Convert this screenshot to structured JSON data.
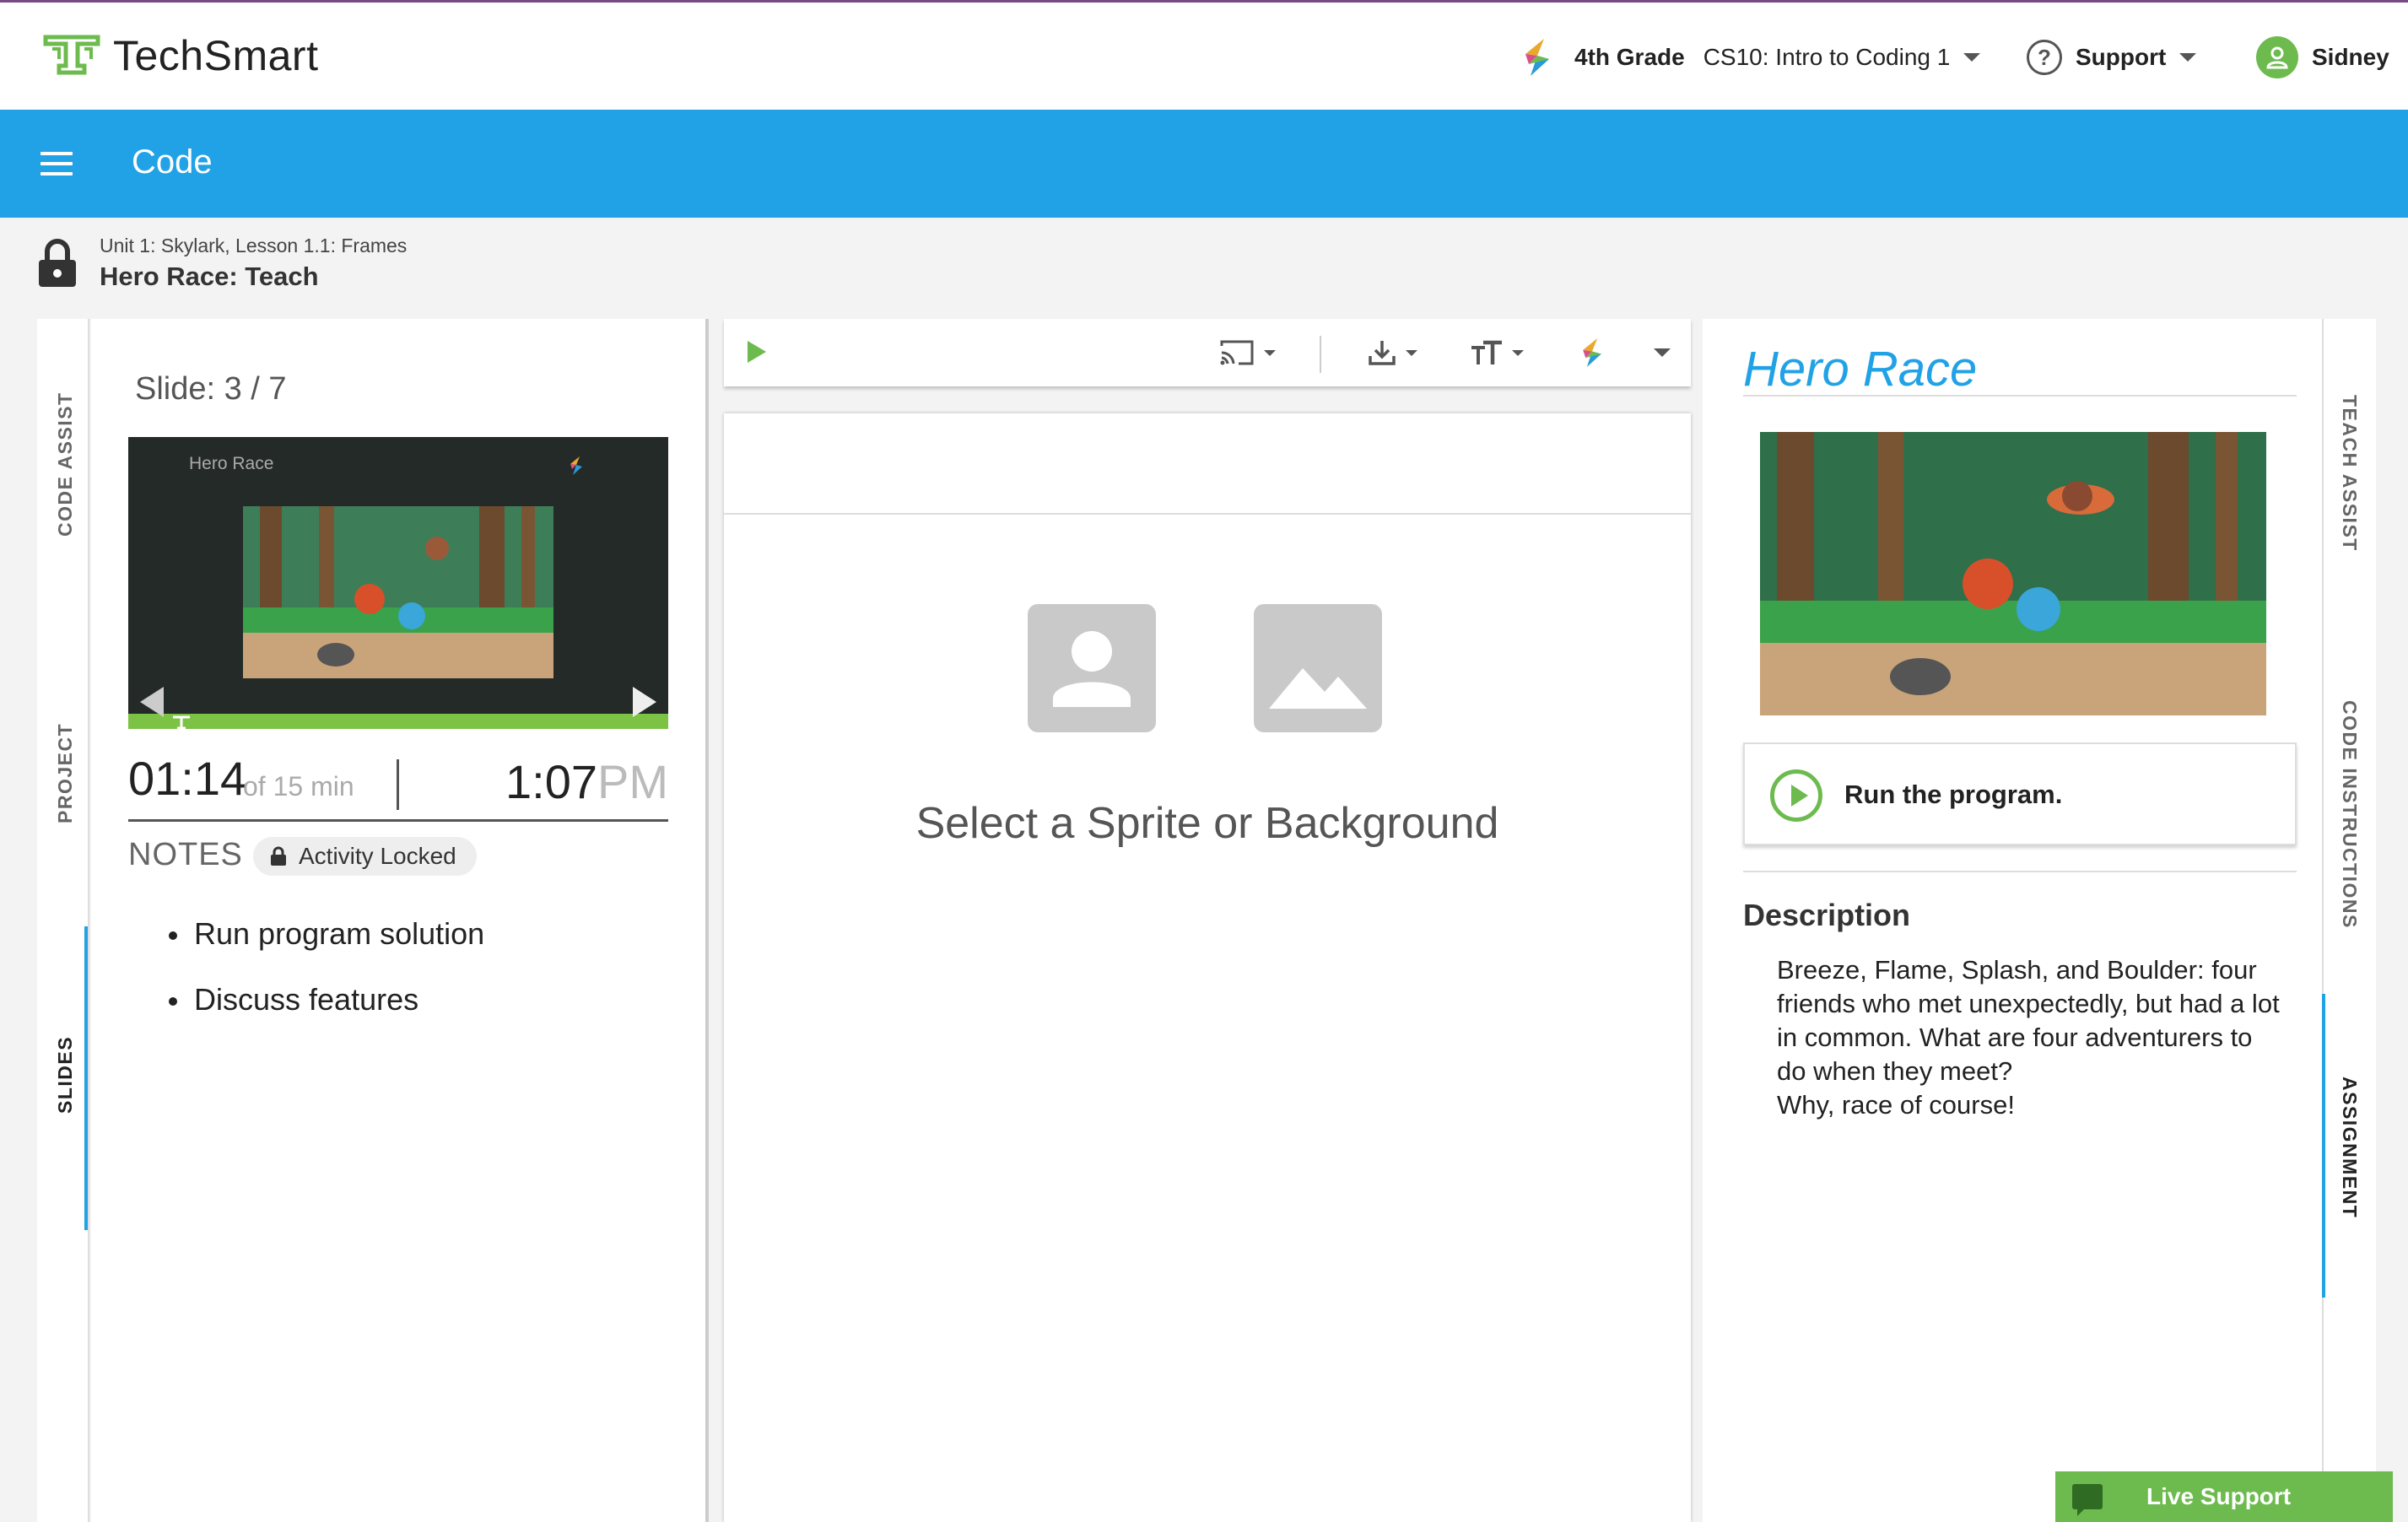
{
  "header": {
    "brand": "TechSmart",
    "grade": "4th Grade",
    "course": "CS10: Intro to Coding 1",
    "support_label": "Support",
    "user_name": "Sidney"
  },
  "appbar": {
    "title": "Code"
  },
  "breadcrumb": {
    "path": "Unit 1: Skylark, Lesson 1.1: Frames",
    "title": "Hero Race: Teach"
  },
  "left_tabs": [
    "CODE ASSIST",
    "PROJECT",
    "SLIDES"
  ],
  "left_tabs_active": "SLIDES",
  "slides": {
    "counter": "Slide: 3 / 7",
    "thumb_title": "Hero Race",
    "elapsed": "01:14",
    "duration": "of 15 min",
    "clock_time": "1:07",
    "clock_ampm": "PM",
    "notes_label": "NOTES",
    "activity_status": "Activity Locked",
    "notes": [
      "Run program solution",
      "Discuss features"
    ]
  },
  "editor": {
    "empty_message": "Select a Sprite or Background"
  },
  "assignment": {
    "title": "Hero Race",
    "task": "Run the program.",
    "description_heading": "Description",
    "description": "Breeze, Flame, Splash, and Boulder: four friends who met unexpectedly, but had a lot in common. What are four adventurers to do when they meet?\nWhy, race of course!"
  },
  "right_tabs": [
    "TEACH ASSIST",
    "CODE INSTRUCTIONS",
    "ASSIGNMENT"
  ],
  "right_tabs_active": "ASSIGNMENT",
  "live_support": "Live Support",
  "colors": {
    "accent_blue": "#22a2e6",
    "accent_green": "#6dbb4f",
    "header_top_border": "#7a4a86"
  }
}
